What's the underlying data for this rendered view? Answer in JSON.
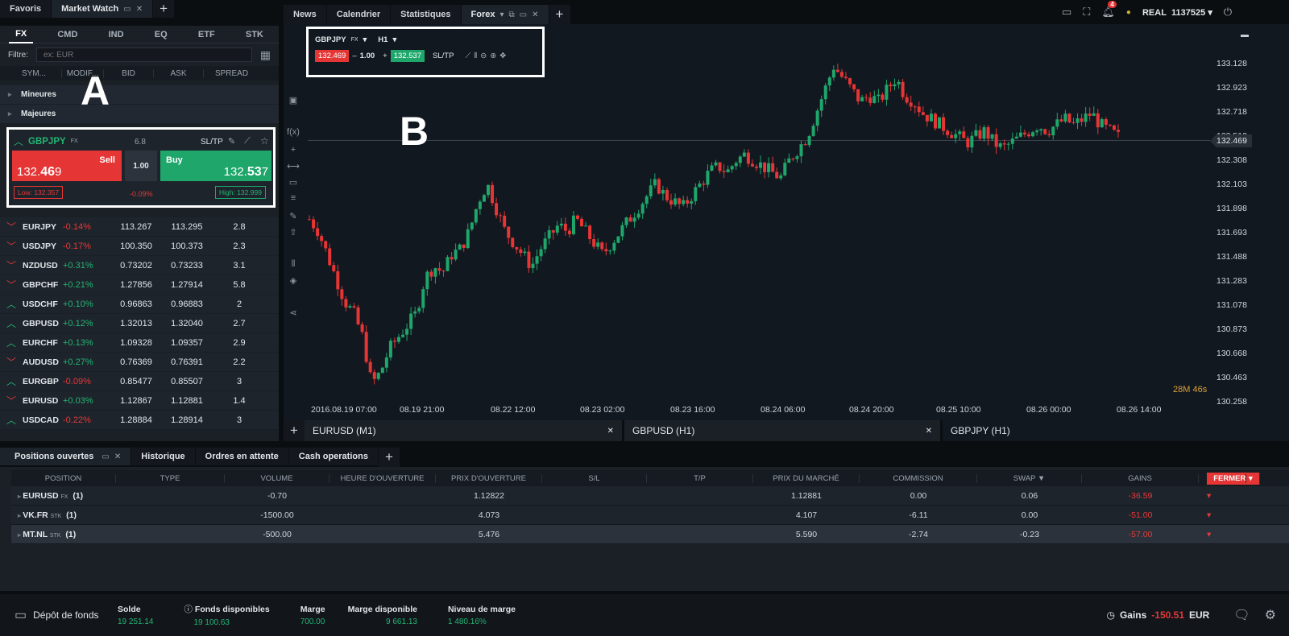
{
  "left_tabs": [
    "Favoris",
    "Market Watch"
  ],
  "categories": [
    "FX",
    "CMD",
    "IND",
    "EQ",
    "ETF",
    "STK"
  ],
  "filter": {
    "label": "Filtre:",
    "placeholder": "ex: EUR"
  },
  "mw_columns": [
    "SYM...",
    "MODIF...",
    "BID",
    "ASK",
    "SPREAD"
  ],
  "groups": [
    "Mineures",
    "Majeures"
  ],
  "annot": {
    "a": "A",
    "b": "B"
  },
  "card": {
    "symbol": "GBPJPY",
    "type": "FX",
    "spread": "6.8",
    "sltp": "SL/TP",
    "sell": "Sell",
    "buy": "Buy",
    "bid_main": "132.",
    "bid_big": "46",
    "bid_small": "9",
    "ask_main": "132.",
    "ask_big": "53",
    "ask_small": "7",
    "volume": "1.00",
    "low": "Low: 132.357",
    "high": "High: 132.999",
    "change": "-0.09%"
  },
  "rows": [
    {
      "sym": "EURJPY",
      "chg": "-0.14%",
      "bid": "113.267",
      "ask": "113.295",
      "spread": "2.8",
      "dir": "dn"
    },
    {
      "sym": "USDJPY",
      "chg": "-0.17%",
      "bid": "100.350",
      "ask": "100.373",
      "spread": "2.3",
      "dir": "dn"
    },
    {
      "sym": "NZDUSD",
      "chg": "+0.31%",
      "bid": "0.73202",
      "ask": "0.73233",
      "spread": "3.1",
      "dir": "dn"
    },
    {
      "sym": "GBPCHF",
      "chg": "+0.21%",
      "bid": "1.27856",
      "ask": "1.27914",
      "spread": "5.8",
      "dir": "dn"
    },
    {
      "sym": "USDCHF",
      "chg": "+0.10%",
      "bid": "0.96863",
      "ask": "0.96883",
      "spread": "2",
      "dir": "up"
    },
    {
      "sym": "GBPUSD",
      "chg": "+0.12%",
      "bid": "1.32013",
      "ask": "1.32040",
      "spread": "2.7",
      "dir": "up"
    },
    {
      "sym": "EURCHF",
      "chg": "+0.13%",
      "bid": "1.09328",
      "ask": "1.09357",
      "spread": "2.9",
      "dir": "up"
    },
    {
      "sym": "AUDUSD",
      "chg": "+0.27%",
      "bid": "0.76369",
      "ask": "0.76391",
      "spread": "2.2",
      "dir": "dn"
    },
    {
      "sym": "EURGBP",
      "chg": "-0.09%",
      "bid": "0.85477",
      "ask": "0.85507",
      "spread": "3",
      "dir": "up"
    },
    {
      "sym": "EURUSD",
      "chg": "+0.03%",
      "bid": "1.12867",
      "ask": "1.12881",
      "spread": "1.4",
      "dir": "dn"
    },
    {
      "sym": "USDCAD",
      "chg": "-0.22%",
      "bid": "1.28884",
      "ask": "1.28914",
      "spread": "3",
      "dir": "up"
    }
  ],
  "chart_tabs": [
    "News",
    "Calendrier",
    "Statistiques",
    "Forex"
  ],
  "top_right": {
    "notif": "4",
    "account_type": "REAL",
    "account_id": "1137525"
  },
  "chart": {
    "symbol": "GBPJPY",
    "type": "FX",
    "tf": "H1",
    "sell": "132.469",
    "vol": "1.00",
    "buy": "132.537",
    "sltp": "SL/TP",
    "minus": "–",
    "plus": "+",
    "last": "132.469",
    "timer_m": "28M",
    "timer_s": "46s"
  },
  "chart_data": {
    "type": "candlestick",
    "yticks": [
      "133.128",
      "132.923",
      "132.718",
      "132.513",
      "132.308",
      "132.103",
      "131.898",
      "131.693",
      "131.488",
      "131.283",
      "131.078",
      "130.873",
      "130.668",
      "130.463",
      "130.258"
    ],
    "xticks": [
      "2016.08.19 07:00",
      "08.19 21:00",
      "08.22 12:00",
      "08.23 02:00",
      "08.23 16:00",
      "08.24 06:00",
      "08.24 20:00",
      "08.25 10:00",
      "08.26 00:00",
      "08.26 14:00"
    ],
    "ylim": [
      130.258,
      133.128
    ],
    "close_path": [
      131.8,
      131.7,
      131.5,
      131.3,
      131.1,
      131.0,
      130.8,
      130.4,
      130.5,
      130.7,
      130.8,
      130.9,
      131.0,
      131.3,
      131.4,
      131.35,
      131.5,
      131.55,
      131.7,
      131.95,
      132.1,
      131.9,
      131.7,
      131.6,
      131.5,
      131.4,
      131.55,
      131.65,
      131.75,
      131.7,
      131.8,
      131.7,
      131.6,
      131.5,
      131.6,
      131.7,
      131.8,
      131.9,
      132.0,
      132.1,
      132.0,
      131.95,
      131.9,
      132.0,
      132.1,
      132.2,
      132.25,
      132.2,
      132.3,
      132.35,
      132.3,
      132.25,
      132.2,
      132.15,
      132.3,
      132.4,
      132.5,
      132.7,
      132.9,
      133.1,
      133.0,
      132.9,
      132.8,
      132.85,
      132.8,
      132.9,
      133.0,
      132.85,
      132.8,
      132.7,
      132.65,
      132.6,
      132.55,
      132.5,
      132.45,
      132.5,
      132.55,
      132.45,
      132.4,
      132.45,
      132.5,
      132.55,
      132.6,
      132.55,
      132.6,
      132.65,
      132.6,
      132.65,
      132.7,
      132.6,
      132.55,
      132.5
    ]
  },
  "bottom_tabs": [
    "EURUSD (M1)",
    "GBPUSD (H1)",
    "GBPJPY (H1)"
  ],
  "pos_tabs": [
    "Positions ouvertes",
    "Historique",
    "Ordres en attente",
    "Cash operations"
  ],
  "pos_columns": [
    "Position",
    "Type",
    "Volume",
    "Heure d'ouverture",
    "Prix d'ouverture",
    "S/L",
    "T/P",
    "Prix du marché",
    "Commission",
    "Swap ▼",
    "Gains",
    ""
  ],
  "fermer": "FERMER",
  "positions": [
    {
      "sym": "EURUSD",
      "type": "FX",
      "count": "(1)",
      "volume": "-0.70",
      "open": "1.12822",
      "market": "1.12881",
      "comm": "0.00",
      "swap": "0.06",
      "gain": "-36.59"
    },
    {
      "sym": "VK.FR",
      "type": "STK",
      "count": "(1)",
      "volume": "-1500.00",
      "open": "4.073",
      "market": "4.107",
      "comm": "-6.11",
      "swap": "0.00",
      "gain": "-51.00"
    },
    {
      "sym": "MT.NL",
      "type": "STK",
      "count": "(1)",
      "volume": "-500.00",
      "open": "5.476",
      "market": "5.590",
      "comm": "-2.74",
      "swap": "-0.23",
      "gain": "-57.00"
    }
  ],
  "footer": {
    "deposit": "Dépôt de fonds",
    "solde_l": "Solde",
    "solde": "19 251.14",
    "fonds_l": "Fonds disponibles",
    "fonds": "19 100.63",
    "marge_l": "Marge",
    "marge": "700.00",
    "margedisp_l": "Marge disponible",
    "margedisp": "9 661.13",
    "niveau_l": "Niveau de marge",
    "niveau": "1 480.16%",
    "gains_l": "Gains",
    "gains": "-150.51",
    "cur": "EUR"
  }
}
